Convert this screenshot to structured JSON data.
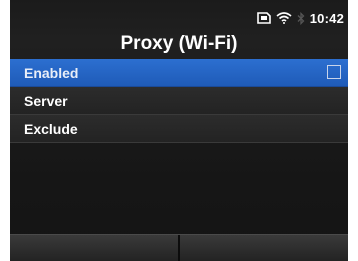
{
  "status": {
    "time": "10:42",
    "icons": [
      "sd-card-icon",
      "wifi-icon",
      "bluetooth-icon"
    ]
  },
  "title": "Proxy (Wi-Fi)",
  "menu": {
    "items": [
      {
        "label": "Enabled",
        "selected": true,
        "checked": false
      },
      {
        "label": "Server"
      },
      {
        "label": "Exclude"
      }
    ]
  },
  "softkeys": {
    "left": "",
    "right": ""
  },
  "colors": {
    "selection": "#2466c8",
    "background": "#1c1c1c",
    "text": "#ffffff"
  }
}
